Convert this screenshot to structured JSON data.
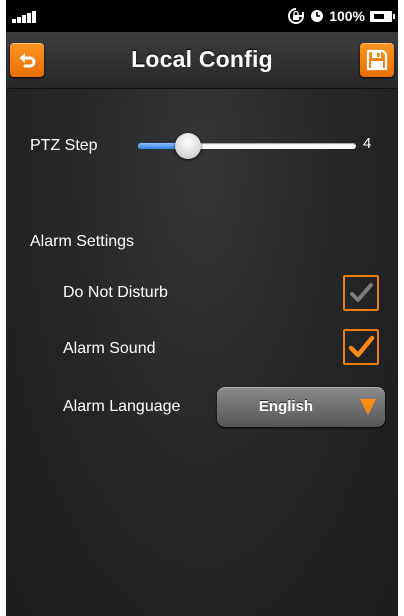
{
  "status_bar": {
    "battery_percent": "100%",
    "icons": [
      "signal-bars-icon",
      "rotation-lock-icon",
      "alarm-clock-icon",
      "battery-charging-icon"
    ]
  },
  "nav": {
    "title": "Local Config",
    "left_icon": "back-arrow-icon",
    "right_icon": "save-floppy-icon"
  },
  "ptz": {
    "label": "PTZ Step",
    "value": "4",
    "slider_fraction": 0.23
  },
  "alarm": {
    "section_title": "Alarm Settings",
    "do_not_disturb_label": "Do Not Disturb",
    "do_not_disturb_checked": false,
    "alarm_sound_label": "Alarm Sound",
    "alarm_sound_checked": true,
    "language_label": "Alarm Language",
    "language_value": "English"
  },
  "colors": {
    "accent_orange": "#f07c0e",
    "slider_blue": "#2f7fe0",
    "background": "#242527"
  }
}
